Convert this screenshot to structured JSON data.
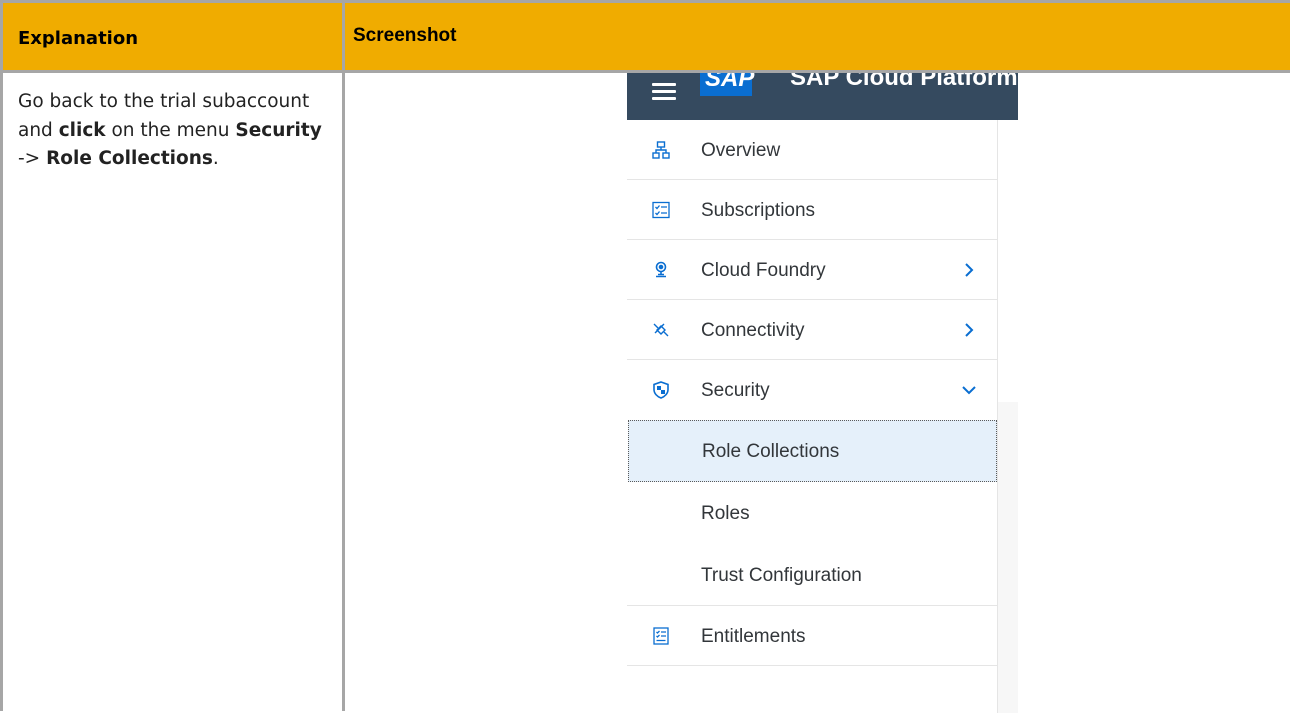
{
  "table": {
    "header_explanation": "Explanation",
    "header_screenshot": "Screenshot",
    "explanation": {
      "part1": "Go back to the trial subaccount and ",
      "click": "click",
      "part2": " on the menu ",
      "security": "Security",
      "arrow": " -> ",
      "role_collections": "Role Collections",
      "end": "."
    }
  },
  "shell": {
    "logo": "SAP",
    "title": "SAP Cloud Platform"
  },
  "nav": {
    "items": [
      {
        "label": "Overview",
        "icon": "overview-icon"
      },
      {
        "label": "Subscriptions",
        "icon": "subscriptions-icon"
      },
      {
        "label": "Cloud Foundry",
        "icon": "cloud-foundry-icon",
        "chevron": "right"
      },
      {
        "label": "Connectivity",
        "icon": "connectivity-icon",
        "chevron": "right"
      },
      {
        "label": "Security",
        "icon": "shield-icon",
        "chevron": "down",
        "expanded": true
      },
      {
        "label": "Entitlements",
        "icon": "entitlements-icon"
      }
    ],
    "security_children": [
      {
        "label": "Role Collections",
        "selected": true
      },
      {
        "label": "Roles"
      },
      {
        "label": "Trust Configuration"
      }
    ]
  },
  "colors": {
    "header_bg": "#f0ac00",
    "shell_bg": "#354a5f",
    "accent": "#0a6ed1",
    "selected_bg": "#e5f0fa"
  }
}
